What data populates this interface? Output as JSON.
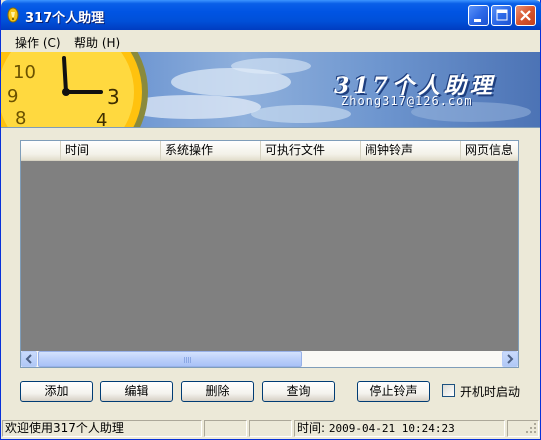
{
  "window": {
    "title": "317个人助理",
    "controls": {
      "minimize": "minimize-icon",
      "maximize": "maximize-icon",
      "close": "close-icon"
    }
  },
  "menu": {
    "items": [
      {
        "label": "操作",
        "accel": "(C)"
      },
      {
        "label": "帮助",
        "accel": "(H)"
      }
    ]
  },
  "banner": {
    "title": "317个人助理",
    "subtitle": "Zhong317@126.com",
    "clock_numbers": [
      "10",
      "9",
      "8",
      "3",
      "4"
    ]
  },
  "list": {
    "columns": [
      "",
      "时间",
      "系统操作",
      "可执行文件",
      "闹钟铃声",
      "网页信息"
    ],
    "rows": []
  },
  "buttons": {
    "add": "添加",
    "edit": "编辑",
    "delete": "删除",
    "query": "查询",
    "stop_ring": "停止铃声"
  },
  "autostart": {
    "label": "开机时启动",
    "checked": false
  },
  "status": {
    "welcome": "欢迎使用317个人助理",
    "pane2": "",
    "pane3": "",
    "time_label": "时间:",
    "time_value": "2009-04-21 10:24:23",
    "pane5": ""
  },
  "colors": {
    "titlebar": "#0054E3",
    "list_background": "#808080",
    "window_face": "#ECE9D8"
  }
}
